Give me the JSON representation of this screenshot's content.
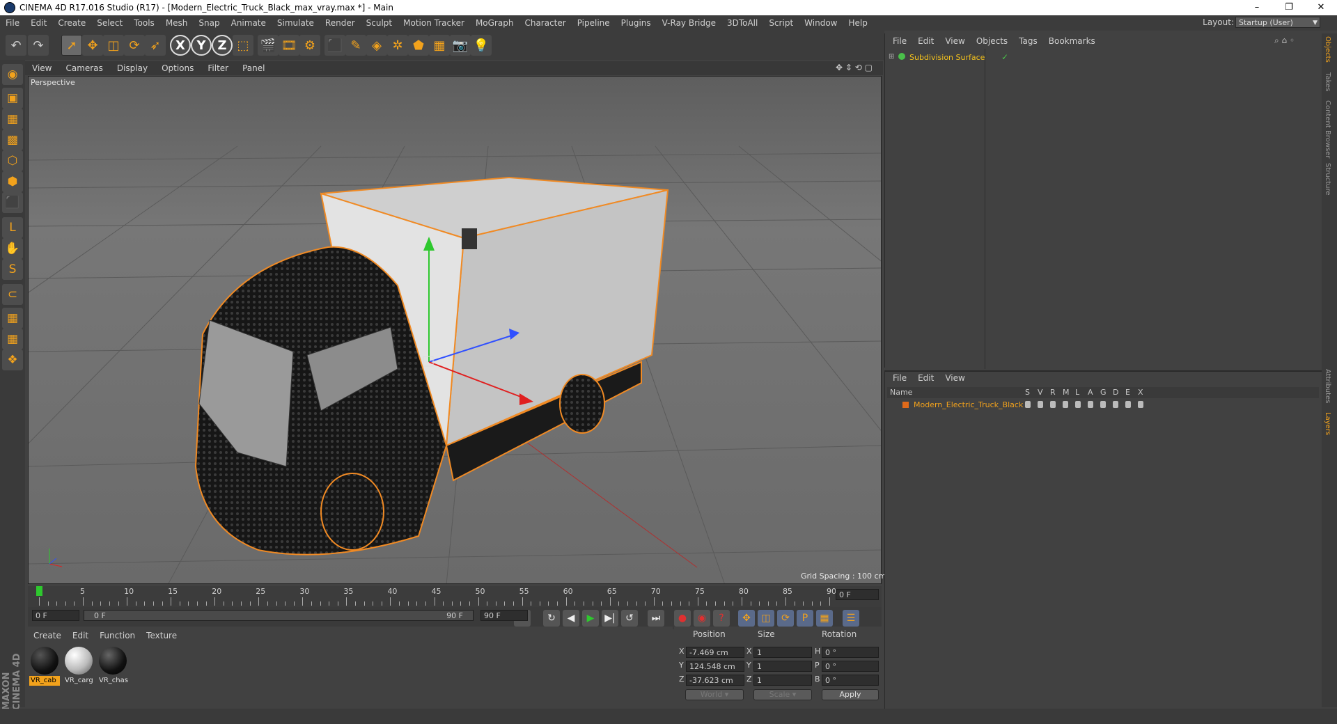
{
  "window": {
    "title": "CINEMA 4D R17.016 Studio (R17) - [Modern_Electric_Truck_Black_max_vray.max *] - Main",
    "controls": [
      "–",
      "❐",
      "✕"
    ]
  },
  "menubar": {
    "items": [
      "File",
      "Edit",
      "Create",
      "Select",
      "Tools",
      "Mesh",
      "Snap",
      "Animate",
      "Simulate",
      "Render",
      "Sculpt",
      "Motion Tracker",
      "MoGraph",
      "Character",
      "Pipeline",
      "Plugins",
      "V-Ray Bridge",
      "3DToAll",
      "Script",
      "Window",
      "Help"
    ],
    "layout_label": "Layout:",
    "layout_value": "Startup (User)"
  },
  "toolbar": {
    "icons": [
      "undo-icon",
      "redo-icon",
      "live-selection-icon",
      "move-icon",
      "scale-icon",
      "rotate-icon",
      "recent-tool-icon",
      "x-axis-icon",
      "y-axis-icon",
      "z-axis-icon",
      "coordinate-system-icon",
      "render-view-icon",
      "render-picture-viewer-icon",
      "edit-render-settings-icon",
      "cube-icon",
      "spline-pen-icon",
      "subdivision-surface-icon",
      "array-icon",
      "deformer-icon",
      "floor-icon",
      "camera-icon",
      "light-icon"
    ],
    "axis_labels": [
      "X",
      "Y",
      "Z"
    ]
  },
  "left_tools": [
    "make-editable-icon",
    "model-mode-icon",
    "texture-mode-icon",
    "workplane-icon",
    "points-mode-icon",
    "edges-mode-icon",
    "polygons-mode-icon",
    "axis-mode-icon",
    "tweak-mode-icon",
    "snap-icon",
    "magnet-icon",
    "grid-lock-icon",
    "quantize-icon",
    "python-icon"
  ],
  "left_tool_glyphs": [
    "◉",
    "▣",
    "▦",
    "▩",
    "⬡",
    "⬢",
    "⬛",
    "L",
    "✋",
    "S",
    "⊂",
    "▦",
    "▦",
    "❖"
  ],
  "viewport": {
    "menu": [
      "View",
      "Cameras",
      "Display",
      "Options",
      "Filter",
      "Panel"
    ],
    "camera_label": "Perspective",
    "grid_spacing": "Grid Spacing : 100 cm"
  },
  "timeline": {
    "ticks": [
      "0",
      "5",
      "10",
      "15",
      "20",
      "25",
      "30",
      "35",
      "40",
      "45",
      "50",
      "55",
      "60",
      "65",
      "70",
      "75",
      "80",
      "85",
      "90"
    ],
    "end_field": "0 F",
    "current_frame": 0,
    "start_field": "0 F",
    "range_start": "0 F",
    "range_end": "90 F",
    "end_frame_field": "90 F"
  },
  "material_manager": {
    "menu": [
      "Create",
      "Edit",
      "Function",
      "Texture"
    ],
    "materials": [
      {
        "name": "VR_cab",
        "selected": true
      },
      {
        "name": "VR_carg",
        "selected": false
      },
      {
        "name": "VR_chas",
        "selected": false
      }
    ]
  },
  "coordinates": {
    "headers": [
      "Position",
      "Size",
      "Rotation"
    ],
    "rows": [
      {
        "axis": "X",
        "position": "-7.469 cm",
        "size_axis": "X",
        "size": "1",
        "rot_axis": "H",
        "rotation": "0 °"
      },
      {
        "axis": "Y",
        "position": "124.548 cm",
        "size_axis": "Y",
        "size": "1",
        "rot_axis": "P",
        "rotation": "0 °"
      },
      {
        "axis": "Z",
        "position": "-37.623 cm",
        "size_axis": "Z",
        "size": "1",
        "rot_axis": "B",
        "rotation": "0 °"
      }
    ],
    "mode1": "World",
    "mode2": "Scale",
    "apply": "Apply"
  },
  "object_manager": {
    "menu": [
      "File",
      "Edit",
      "View",
      "Objects",
      "Tags",
      "Bookmarks"
    ],
    "objects": [
      {
        "name": "Subdivision Surface",
        "checked": "✓"
      }
    ]
  },
  "layer_manager": {
    "menu": [
      "File",
      "Edit",
      "View"
    ],
    "columns": [
      "Name",
      "S",
      "V",
      "R",
      "M",
      "L",
      "A",
      "G",
      "D",
      "E",
      "X"
    ],
    "layers": [
      {
        "name": "Modern_Electric_Truck_Black",
        "color": "#e06a1a"
      }
    ]
  },
  "side_tabs": [
    "Objects",
    "Takes",
    "Content Browser",
    "Structure",
    "Attributes",
    "Layers"
  ],
  "branding": {
    "text": "MAXON CINEMA 4D"
  },
  "colors": {
    "accent": "#f2a21c",
    "selection_orange": "#f08a24",
    "panel": "#414141"
  }
}
